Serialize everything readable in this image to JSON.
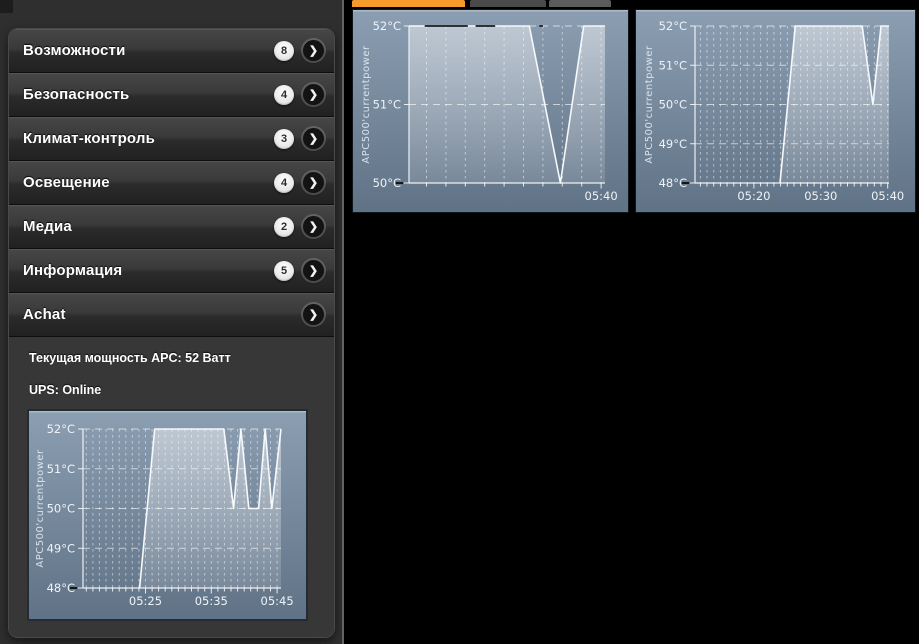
{
  "sidebar": {
    "items": [
      {
        "label": "Возможности",
        "count": "8"
      },
      {
        "label": "Безопасность",
        "count": "4"
      },
      {
        "label": "Климат-контроль",
        "count": "3"
      },
      {
        "label": "Освещение",
        "count": "4"
      },
      {
        "label": "Медиа",
        "count": "2"
      },
      {
        "label": "Информация",
        "count": "5"
      },
      {
        "label": "Achat",
        "count": null
      }
    ],
    "expanded": {
      "power_text": "Текущая мощность APC: 52 Ватт",
      "ups_text": "UPS: Online"
    }
  },
  "tabs": [
    {
      "name": "active-tab",
      "color": "#f59b2c"
    },
    {
      "name": "tab-2",
      "color": "#4a4a4a"
    },
    {
      "name": "tab-3",
      "color": "#5c5c5c"
    }
  ],
  "colors": {
    "page_bg": "#000000",
    "sidebar_bg": "#2f2f2f",
    "accent_orange": "#f59b2c",
    "chart_line": "#f6f8fa",
    "chart_text": "#eef3f8"
  },
  "chart_data": [
    {
      "type": "line",
      "title": "",
      "ylabel": "APC500'currentpower",
      "y_unit": "°C",
      "ylim": [
        50,
        52
      ],
      "grid": true,
      "legend_position": "none",
      "panel_top": "#8c9eb2",
      "panel_bottom": "#607285",
      "y_ticks": [
        {
          "v": 50,
          "label": "50°C"
        },
        {
          "v": 51,
          "label": "51°C"
        },
        {
          "v": 52,
          "label": "52°C"
        }
      ],
      "xlim_minutes_after_05": [
        30.1,
        40.2
      ],
      "x_ticks": [
        {
          "minute": 40,
          "label": "05:40"
        }
      ],
      "minor_grid_step_minutes": 1,
      "series": [
        {
          "name": "APC500 current power",
          "points_minute_value": [
            [
              30.1,
              52
            ],
            [
              36.3,
              52
            ],
            [
              37.9,
              50
            ],
            [
              39.1,
              52
            ],
            [
              40.2,
              52
            ]
          ]
        }
      ],
      "dark_top_segments_fraction": [
        [
          0.08,
          0.3
        ],
        [
          0.34,
          0.44
        ],
        [
          0.665,
          0.683
        ]
      ]
    },
    {
      "type": "line",
      "title": "",
      "ylabel": "APC500'currentpower",
      "y_unit": "°C",
      "ylim": [
        48,
        52
      ],
      "grid": true,
      "legend_position": "none",
      "panel_top": "#8c9eb2",
      "panel_bottom": "#607285",
      "y_ticks": [
        {
          "v": 48,
          "label": "48°C"
        },
        {
          "v": 49,
          "label": "49°C"
        },
        {
          "v": 50,
          "label": "50°C"
        },
        {
          "v": 51,
          "label": "51°C"
        },
        {
          "v": 52,
          "label": "52°C"
        }
      ],
      "xlim_minutes_after_05": [
        11.2,
        40.2
      ],
      "x_ticks": [
        {
          "minute": 20,
          "label": "05:20"
        },
        {
          "minute": 30,
          "label": "05:30"
        },
        {
          "minute": 40,
          "label": "05:40"
        }
      ],
      "minor_grid_step_minutes": 1,
      "series": [
        {
          "name": "APC500 current power",
          "points_minute_value": [
            [
              23.9,
              48
            ],
            [
              26.2,
              52
            ],
            [
              36.2,
              52
            ],
            [
              37.8,
              50
            ],
            [
              39.0,
              52
            ],
            [
              40.2,
              52
            ]
          ]
        }
      ],
      "dark_top_segments_fraction": []
    },
    {
      "type": "line",
      "title": "",
      "ylabel": "APC500'currentpower",
      "y_unit": "°C",
      "ylim": [
        48,
        52
      ],
      "grid": true,
      "legend_position": "none",
      "panel_top": "#8c9eb2",
      "panel_bottom": "#607285",
      "y_ticks": [
        {
          "v": 48,
          "label": "48°C"
        },
        {
          "v": 49,
          "label": "49°C"
        },
        {
          "v": 50,
          "label": "50°C"
        },
        {
          "v": 51,
          "label": "51°C"
        },
        {
          "v": 52,
          "label": "52°C"
        }
      ],
      "xlim_minutes_after_05": [
        15.5,
        45.6
      ],
      "x_ticks": [
        {
          "minute": 25,
          "label": "05:25"
        },
        {
          "minute": 35,
          "label": "05:35"
        },
        {
          "minute": 45,
          "label": "05:45"
        }
      ],
      "minor_grid_step_minutes": 1,
      "series": [
        {
          "name": "APC500 current power",
          "points_minute_value": [
            [
              24.1,
              48
            ],
            [
              26.4,
              52
            ],
            [
              36.9,
              52
            ],
            [
              38.4,
              50
            ],
            [
              39.5,
              52
            ],
            [
              40.7,
              50
            ],
            [
              42.2,
              50
            ],
            [
              43.2,
              52
            ],
            [
              44.2,
              50
            ],
            [
              45.6,
              52
            ]
          ]
        }
      ],
      "dark_top_segments_fraction": []
    }
  ]
}
